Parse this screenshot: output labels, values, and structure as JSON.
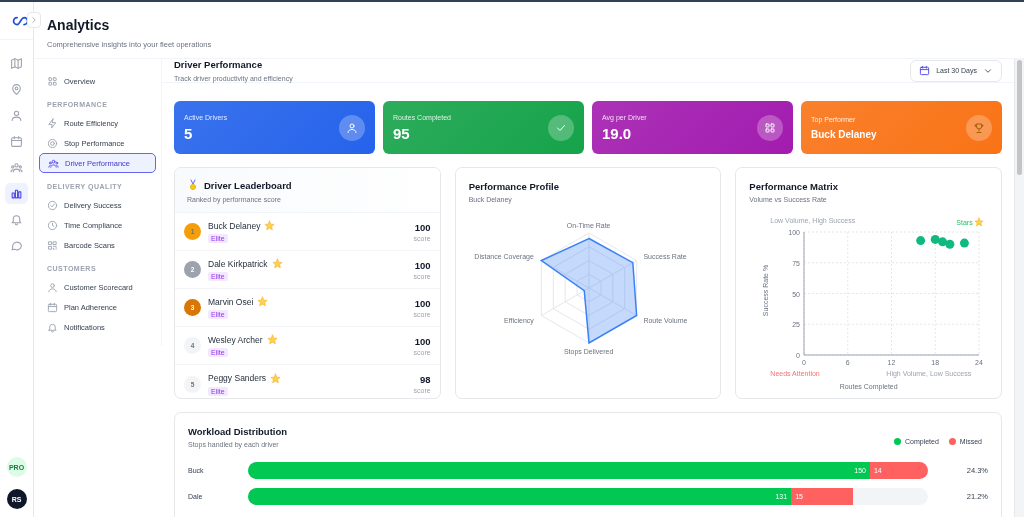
{
  "header": {
    "title": "Analytics",
    "subtitle": "Comprehensive insights into your fleet operations"
  },
  "rail": {
    "items": [
      {
        "selected": false
      },
      {
        "selected": false
      },
      {
        "selected": false
      },
      {
        "selected": false
      },
      {
        "selected": false
      },
      {
        "selected": true
      },
      {
        "selected": false
      },
      {
        "selected": false
      }
    ],
    "plan_badge": "PRO",
    "avatar": "RS"
  },
  "nav": {
    "sections": [
      {
        "items": [
          {
            "label": "Overview",
            "selected": false
          }
        ]
      },
      {
        "heading": "PERFORMANCE",
        "items": [
          {
            "label": "Route Efficiency",
            "selected": false
          },
          {
            "label": "Stop Performance",
            "selected": false
          },
          {
            "label": "Driver Performance",
            "selected": true
          }
        ]
      },
      {
        "heading": "DELIVERY QUALITY",
        "items": [
          {
            "label": "Delivery Success",
            "selected": false
          },
          {
            "label": "Time Compliance",
            "selected": false
          },
          {
            "label": "Barcode Scans",
            "selected": false
          }
        ]
      },
      {
        "heading": "CUSTOMERS",
        "items": [
          {
            "label": "Customer Scorecard",
            "selected": false
          },
          {
            "label": "Plan Adherence",
            "selected": false
          },
          {
            "label": "Notifications",
            "selected": false
          }
        ]
      }
    ]
  },
  "page": {
    "title": "Driver Performance",
    "subtitle": "Track driver productivity and efficiency",
    "date_range": "Last 30 Days"
  },
  "stats": [
    {
      "kind": "drivers",
      "label": "Active Drivers",
      "value": "5",
      "color": "#2563eb"
    },
    {
      "kind": "routes",
      "label": "Routes Completed",
      "value": "95",
      "color": "#16a34a"
    },
    {
      "kind": "average",
      "label": "Avg per Driver",
      "value": "19.0",
      "color": "#a21caf"
    },
    {
      "kind": "top",
      "label": "Top Performer",
      "value": "Buck Delaney",
      "color": "#f97316"
    }
  ],
  "leaderboard": {
    "title": "Driver Leaderboard",
    "subtitle": "Ranked by performance score",
    "rows": [
      {
        "rank": "1",
        "color": "#f59e0b",
        "name": "Buck Delaney",
        "tier": "Elite",
        "score": "100",
        "score_label": "score"
      },
      {
        "rank": "2",
        "color": "#9ca3af",
        "name": "Dale Kirkpatrick",
        "tier": "Elite",
        "score": "100",
        "score_label": "score"
      },
      {
        "rank": "3",
        "color": "#d97706",
        "name": "Marvin Osei",
        "tier": "Elite",
        "score": "100",
        "score_label": "score"
      },
      {
        "rank": "4",
        "color": "#f3f4f6",
        "name": "Wesley Archer",
        "tier": "Elite",
        "score": "100",
        "score_label": "score"
      },
      {
        "rank": "5",
        "color": "#f3f4f6",
        "name": "Peggy Sanders",
        "tier": "Elite",
        "score": "98",
        "score_label": "score"
      }
    ]
  },
  "profile": {
    "title": "Performance Profile",
    "subtitle": "Buck Delaney",
    "axes": [
      "On-Time Rate",
      "Success Rate",
      "Route Volume",
      "Stops Delivered",
      "Efficiency",
      "Distance Coverage"
    ]
  },
  "matrix": {
    "title": "Performance Matrix",
    "subtitle": "Volume vs Success Rate",
    "quadrant_labels": [
      "Low Volume, High Success",
      "Stars",
      "Needs Attention",
      "High Volume, Low Success"
    ],
    "chart_data": {
      "type": "scatter",
      "xlabel": "Routes Completed",
      "ylabel": "Success Rate %",
      "xlim": [
        0,
        24
      ],
      "ylim": [
        0,
        100
      ],
      "xticks": [
        0,
        6,
        12,
        18,
        24
      ],
      "yticks": [
        0,
        25,
        50,
        75,
        100
      ],
      "grid": true,
      "x": [
        16,
        18,
        19,
        20,
        22
      ],
      "series": [
        {
          "color": "#10b981",
          "values": [
            93,
            94,
            92,
            90,
            91
          ]
        }
      ]
    }
  },
  "workload": {
    "title": "Workload Distribution",
    "subtitle": "Stops handled by each driver",
    "shares": [
      "24.3%",
      "21.2%"
    ],
    "chart_data": {
      "type": "bar",
      "orientation": "horizontal",
      "stacked": true,
      "data_labels": true,
      "categories": [
        "Buck",
        "Dale"
      ],
      "series": [
        {
          "name": "Completed",
          "color": "#00c853",
          "values": [
            150,
            131
          ]
        },
        {
          "name": "Missed",
          "color": "#ff6161",
          "values": [
            14,
            15
          ]
        }
      ]
    }
  }
}
